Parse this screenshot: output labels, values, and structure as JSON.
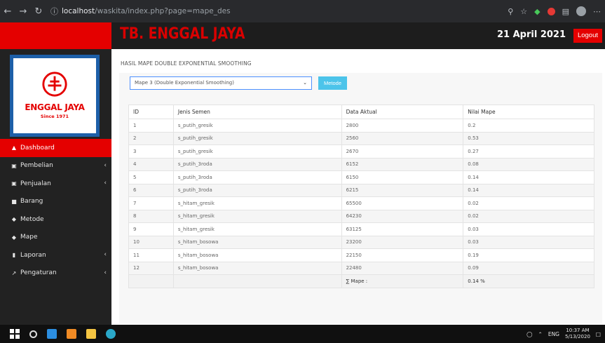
{
  "browser": {
    "host": "localhost",
    "path": "/waskita/index.php?page=mape_des"
  },
  "header": {
    "title": "TB. ENGGAL JAYA",
    "date": "21 April 2021",
    "logout_label": "Logout"
  },
  "logo": {
    "name": "ENGGAL JAYA",
    "since": "Since 1971"
  },
  "sidebar": {
    "items": [
      {
        "label": "Dashboard",
        "icon": "dashboard-icon",
        "active": true,
        "has_chevron": false
      },
      {
        "label": "Pembelian",
        "icon": "cart-icon",
        "active": false,
        "has_chevron": true
      },
      {
        "label": "Penjualan",
        "icon": "sales-icon",
        "active": false,
        "has_chevron": true
      },
      {
        "label": "Barang",
        "icon": "box-icon",
        "active": false,
        "has_chevron": false
      },
      {
        "label": "Metode",
        "icon": "users-icon",
        "active": false,
        "has_chevron": false
      },
      {
        "label": "Mape",
        "icon": "users-icon",
        "active": false,
        "has_chevron": false
      },
      {
        "label": "Laporan",
        "icon": "book-icon",
        "active": false,
        "has_chevron": true
      },
      {
        "label": "Pengaturan",
        "icon": "wrench-icon",
        "active": false,
        "has_chevron": true
      }
    ]
  },
  "main": {
    "section_title": "HASIL MAPE DOUBLE EXPONENTIAL SMOOTHING",
    "select_value": "Mape 3 (Double Exponential Smoothing)",
    "metode_label": "Metode",
    "table": {
      "headers": [
        "ID",
        "Jenis Semen",
        "Data Aktual",
        "Nilai Mape"
      ],
      "rows": [
        [
          "1",
          "s_putih_gresik",
          "2800",
          "0.2"
        ],
        [
          "2",
          "s_putih_gresik",
          "2560",
          "0.53"
        ],
        [
          "3",
          "s_putih_gresik",
          "2670",
          "0.27"
        ],
        [
          "4",
          "s_putih_3roda",
          "6152",
          "0.08"
        ],
        [
          "5",
          "s_putih_3roda",
          "6150",
          "0.14"
        ],
        [
          "6",
          "s_putih_3roda",
          "6215",
          "0.14"
        ],
        [
          "7",
          "s_hitam_gresik",
          "65500",
          "0.02"
        ],
        [
          "8",
          "s_hitam_gresik",
          "64230",
          "0.02"
        ],
        [
          "9",
          "s_hitam_gresik",
          "63125",
          "0.03"
        ],
        [
          "10",
          "s_hitam_bosowa",
          "23200",
          "0.03"
        ],
        [
          "11",
          "s_hitam_bosowa",
          "22150",
          "0.19"
        ],
        [
          "12",
          "s_hitam_bosowa",
          "22480",
          "0.09"
        ]
      ],
      "footer_label": "∑ Mape :",
      "footer_value": "0.14 %"
    }
  },
  "taskbar": {
    "lang": "ENG",
    "time": "10:37 AM",
    "date": "5/13/2020"
  },
  "colors": {
    "brand_red": "#e40000",
    "sidebar_bg": "#222222",
    "metode_button": "#4cc4ea"
  }
}
